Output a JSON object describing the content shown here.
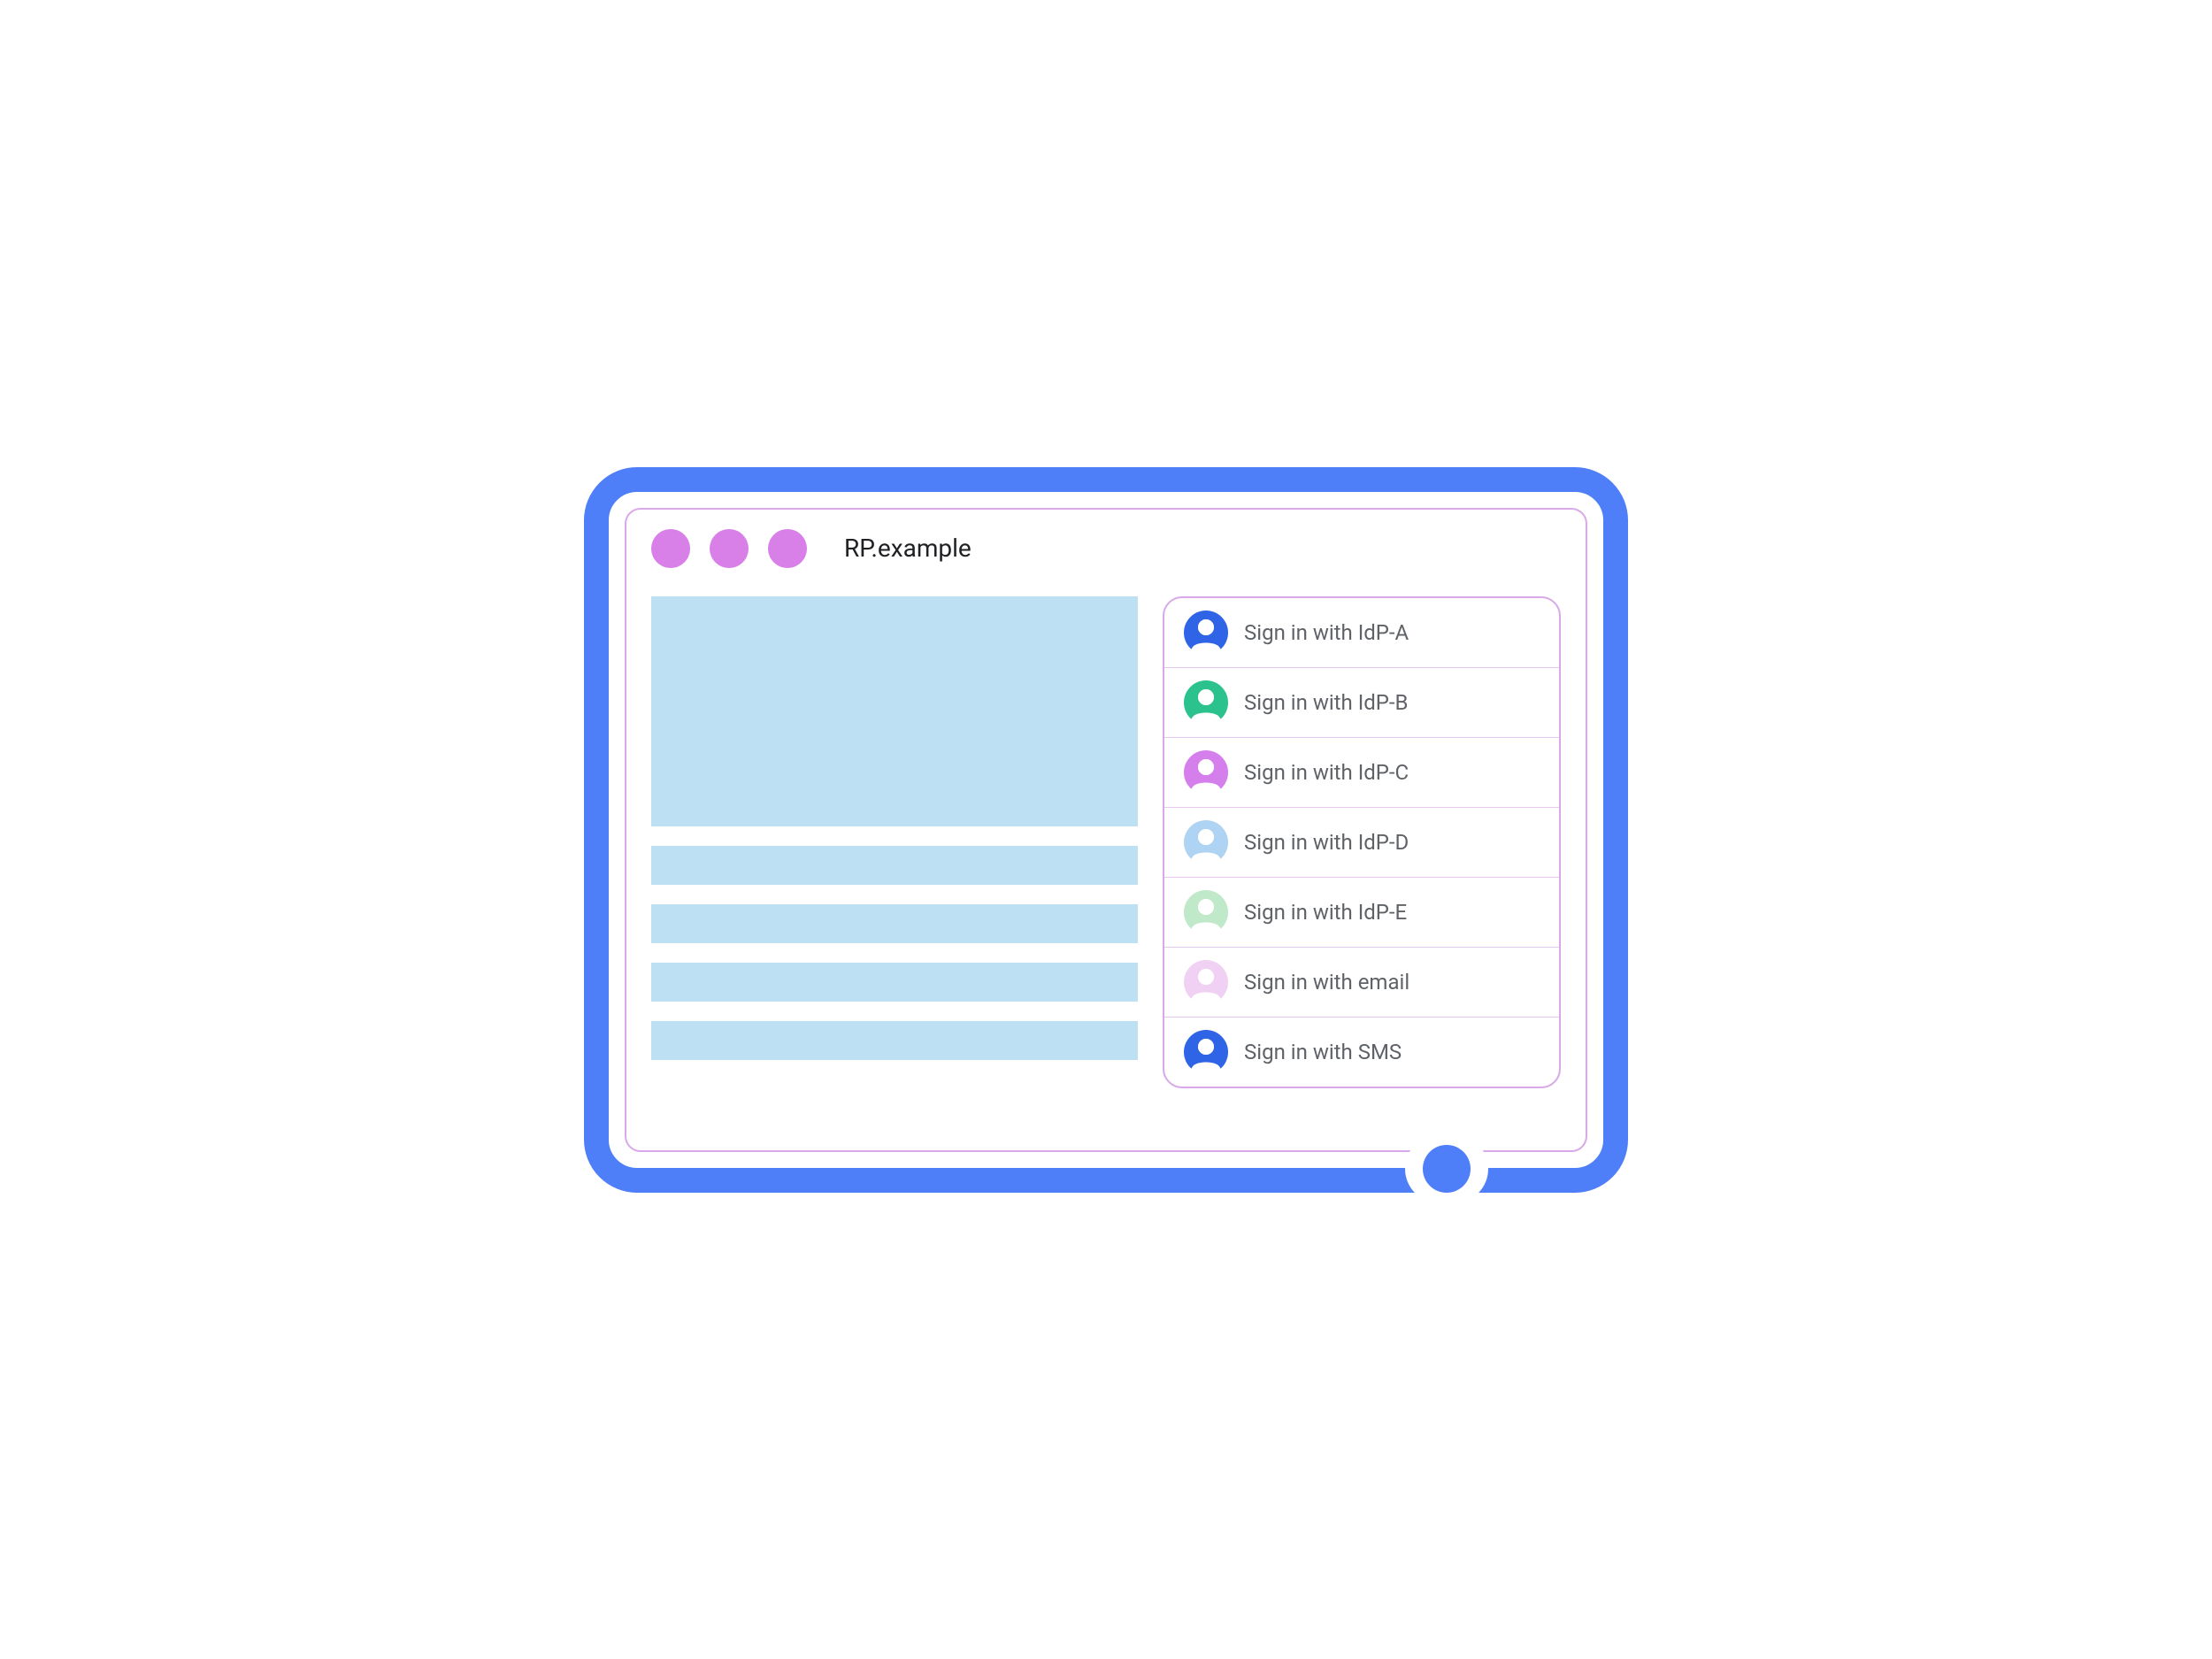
{
  "address_bar": "RP.example",
  "signin_options": [
    {
      "label": "Sign in with IdP-A",
      "icon_color": "#2F64E6"
    },
    {
      "label": "Sign in with IdP-B",
      "icon_color": "#2BC28E"
    },
    {
      "label": "Sign in with IdP-C",
      "icon_color": "#D47FEB"
    },
    {
      "label": "Sign in with IdP-D",
      "icon_color": "#AED3F3"
    },
    {
      "label": "Sign in with IdP-E",
      "icon_color": "#BFE9C9"
    },
    {
      "label": "Sign in with email",
      "icon_color": "#F0D1F3"
    },
    {
      "label": "Sign in with SMS",
      "icon_color": "#2F64E6"
    }
  ],
  "colors": {
    "frame": "#4E7FF9",
    "window_border": "#D9A8E8",
    "traffic_light": "#D980E8",
    "placeholder": "#BDE0F3"
  }
}
